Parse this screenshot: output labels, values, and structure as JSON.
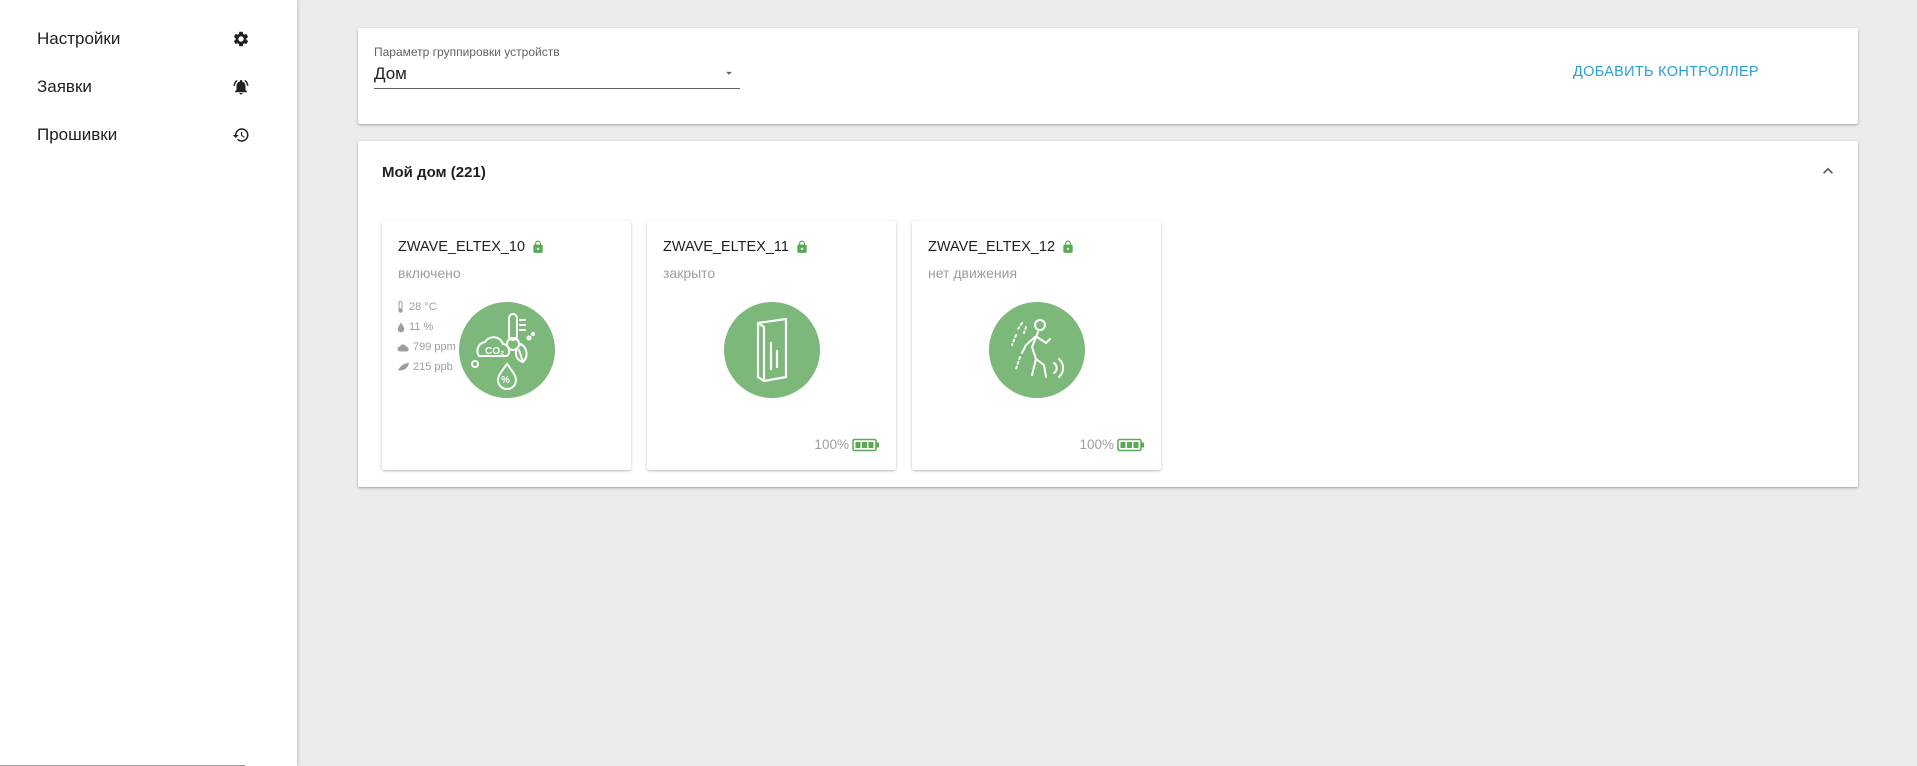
{
  "sidebar": {
    "items": [
      {
        "label": "Настройки",
        "icon": "gear-icon"
      },
      {
        "label": "Заявки",
        "icon": "alarm-bell-icon"
      },
      {
        "label": "Прошивки",
        "icon": "history-icon"
      }
    ]
  },
  "top_panel": {
    "group_label": "Параметр группировки устройств",
    "group_value": "Дом",
    "add_controller": "ДОБАВИТЬ КОНТРОЛЛЕР"
  },
  "home": {
    "title": "Мой дом (221)",
    "devices": [
      {
        "name": "ZWAVE_ELTEX_10",
        "status": "включено",
        "icon": "air-quality-sensor-icon",
        "metrics": [
          {
            "icon": "thermometer-icon",
            "value": "28 °C"
          },
          {
            "icon": "humidity-drop-icon",
            "value": "11 %"
          },
          {
            "icon": "cloud-icon",
            "value": "799 ppm"
          },
          {
            "icon": "leaf-icon",
            "value": "215 ppb"
          }
        ]
      },
      {
        "name": "ZWAVE_ELTEX_11",
        "status": "закрыто",
        "icon": "door-sensor-icon",
        "battery": "100%"
      },
      {
        "name": "ZWAVE_ELTEX_12",
        "status": "нет движения",
        "icon": "motion-sensor-icon",
        "battery": "100%"
      }
    ]
  },
  "colors": {
    "accent": "#2a9fd8",
    "device_green": "#7cb87a",
    "lock_green": "#5aa954",
    "battery_green": "#5aa954",
    "muted_text": "#9e9e9e",
    "background": "#ececec"
  }
}
